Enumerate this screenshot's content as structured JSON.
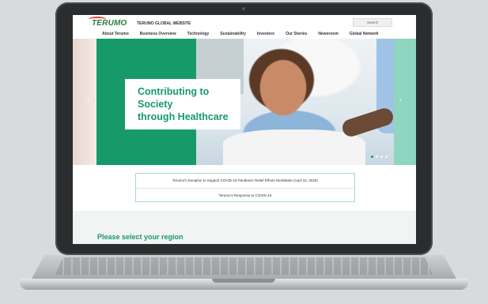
{
  "header": {
    "logo_text": "TERUMO",
    "site_name": "TERUMO GLOBAL WEBSITE",
    "search_label": "Search"
  },
  "nav": {
    "items": [
      "About Terumo",
      "Business Overview",
      "Technology",
      "Sustainability",
      "Investors",
      "Our Stories",
      "Newsroom",
      "Global Network"
    ]
  },
  "hero": {
    "caption": "Contributing to Society\nthrough Healthcare",
    "carousel_slide_count": 4,
    "carousel_active_index": 0
  },
  "news": {
    "items": [
      "Terumo's Donation to Support COVID-19 Pandemic Relief Efforts Worldwide (April 22, 2020)",
      "Terumo's Response to COVID-19"
    ]
  },
  "region": {
    "title": "Please select your region"
  },
  "colors": {
    "brand_green": "#179a6a",
    "logo_red": "#e0452f"
  }
}
